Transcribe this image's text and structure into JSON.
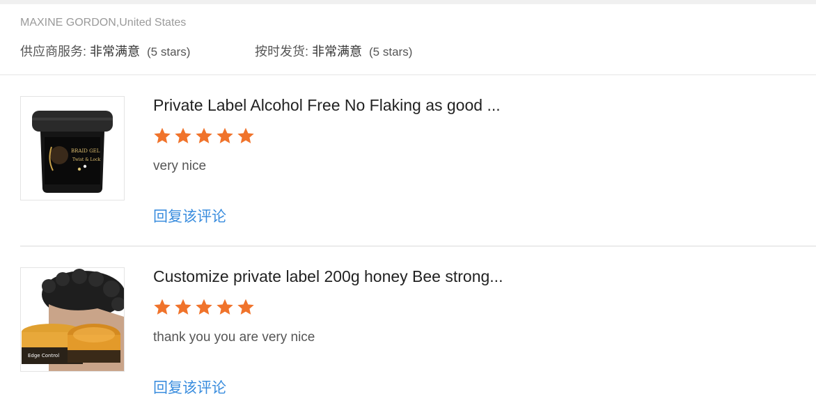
{
  "reviewer": {
    "name_location": "MAXINE GORDON,United States"
  },
  "ratings": {
    "supplier_service": {
      "label": "供应商服务: ",
      "value": "非常满意",
      "stars_text": "(5 stars)"
    },
    "on_time_shipping": {
      "label": "按时发货: ",
      "value": "非常满意",
      "stars_text": "(5 stars)"
    }
  },
  "reviews": [
    {
      "product_title": "Private Label Alcohol Free No Flaking as good ...",
      "rating": 5,
      "comment": "very nice",
      "reply_label": "回复该评论",
      "thumbnail": {
        "label_line1": "BRAID GEL",
        "label_line2": "Twist & Lock"
      }
    },
    {
      "product_title": "Customize private label 200g honey Bee strong...",
      "rating": 5,
      "comment": "thank you you are very nice",
      "reply_label": "回复该评论",
      "thumbnail": {
        "label_line1": "Edge Control"
      }
    }
  ],
  "colors": {
    "star": "#f0732b",
    "link": "#3a8dde"
  }
}
